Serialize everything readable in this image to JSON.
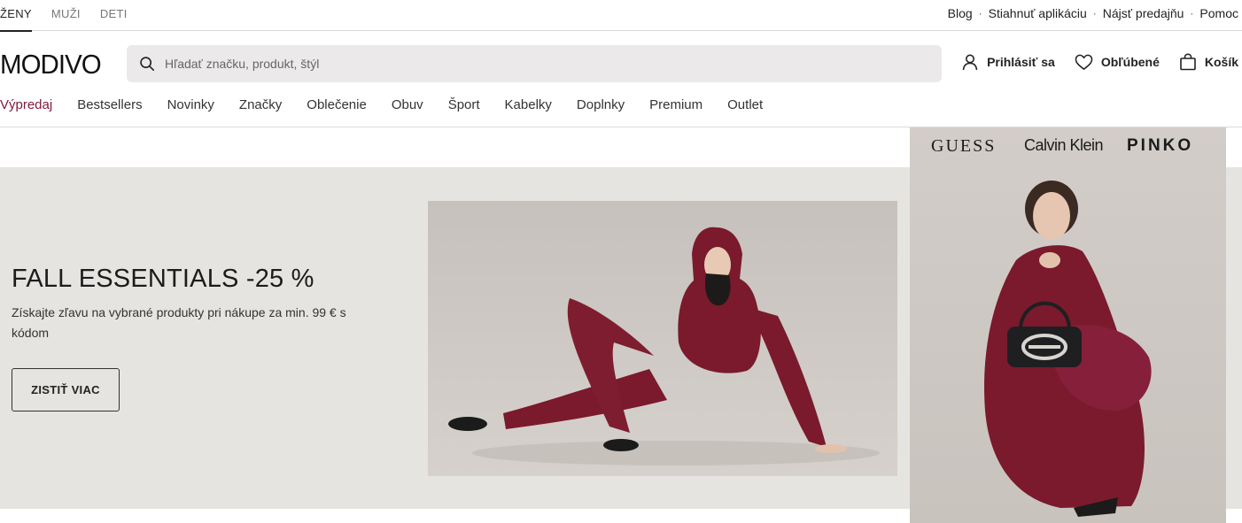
{
  "gender_tabs": [
    {
      "label": "ŽENY",
      "active": true
    },
    {
      "label": "MUŽI",
      "active": false
    },
    {
      "label": "DETI",
      "active": false
    }
  ],
  "utility_links": [
    "Blog",
    "Stiahnuť aplikáciu",
    "Nájsť predajňu",
    "Pomoc"
  ],
  "utility_separator": "·",
  "logo": "MODIVO",
  "search": {
    "placeholder": "Hľadať značku, produkt, štýl"
  },
  "header_actions": {
    "login": "Prihlásiť sa",
    "favorites": "Obľúbené",
    "cart": "Košík"
  },
  "categories": [
    "Výpredaj",
    "Bestsellers",
    "Novinky",
    "Značky",
    "Oblečenie",
    "Obuv",
    "Šport",
    "Kabelky",
    "Doplnky",
    "Premium",
    "Outlet"
  ],
  "hero": {
    "title": "FALL ESSENTIALS -25 %",
    "subtitle": "Získajte zľavu na vybrané produkty pri nákupe za min. 99 € s kódom",
    "button": "ZISTIŤ VIAC"
  },
  "promo_brands": [
    "GUESS",
    "Calvin Klein",
    "PINKO"
  ],
  "colors": {
    "accent_sale": "#7d1a3a",
    "hero_bg": "#e6e4e1",
    "search_bg": "#ebe9ea",
    "outfit": "#7a1a2c"
  },
  "icons": {
    "search": "search-icon",
    "login": "user-icon",
    "favorites": "heart-icon",
    "cart": "shopping-bag-icon"
  }
}
